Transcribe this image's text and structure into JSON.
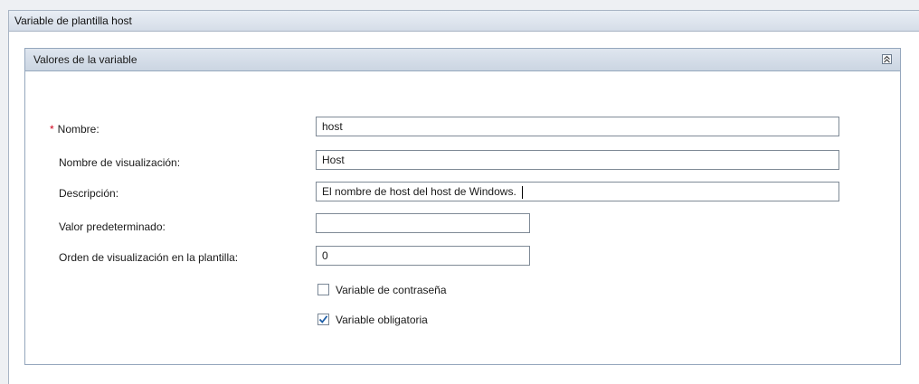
{
  "outer_panel": {
    "title": "Variable de plantilla host"
  },
  "inner_panel": {
    "title": "Valores de la variable",
    "collapse_icon": "double-chevron-up-icon"
  },
  "form": {
    "nombre": {
      "label": "Nombre:",
      "required_marker": "*",
      "value": "host"
    },
    "nombre_visualizacion": {
      "label": "Nombre de visualización:",
      "value": "Host"
    },
    "descripcion": {
      "label": "Descripción:",
      "value": "El nombre de host del host de Windows."
    },
    "valor_predeterminado": {
      "label": "Valor predeterminado:",
      "value": ""
    },
    "orden_visualizacion": {
      "label": "Orden de visualización en la plantilla:",
      "value": "0"
    },
    "variable_contrasena": {
      "label": "Variable de contraseña",
      "checked": false
    },
    "variable_obligatoria": {
      "label": "Variable obligatoria",
      "checked": true
    }
  },
  "colors": {
    "required": "#d0021b",
    "check": "#1f5fa8"
  }
}
